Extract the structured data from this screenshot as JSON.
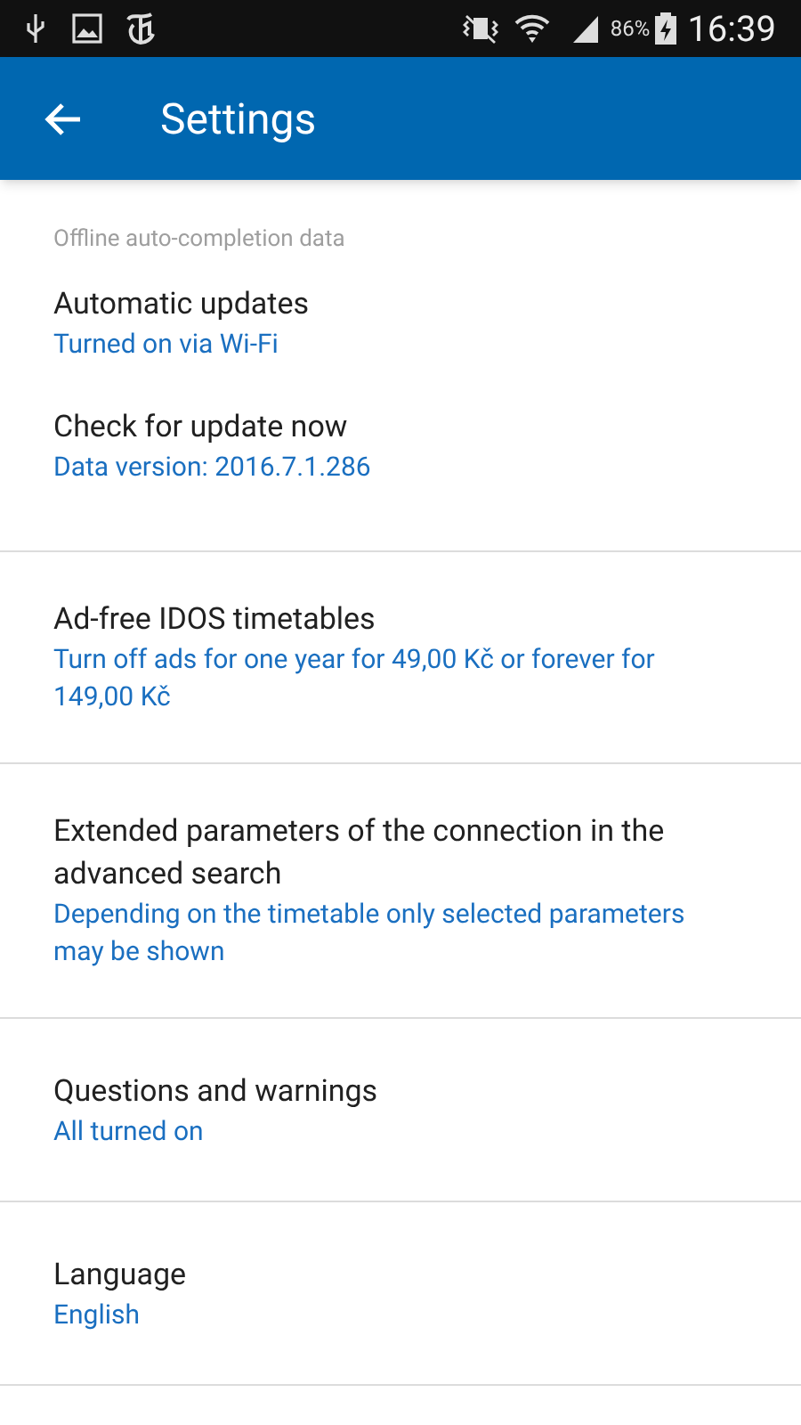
{
  "status_bar": {
    "battery": "86%",
    "time": "16:39"
  },
  "app_bar": {
    "title": "Settings"
  },
  "sections": [
    {
      "header": "Offline auto-completion data",
      "items": [
        {
          "title": "Automatic updates",
          "summary": "Turned on via Wi-Fi"
        },
        {
          "title": "Check for update now",
          "summary": "Data version: 2016.7.1.286"
        }
      ]
    },
    {
      "items": [
        {
          "title": "Ad-free IDOS timetables",
          "summary": "Turn off ads for one year for 49,00 Kč or forever for 149,00 Kč"
        }
      ]
    },
    {
      "items": [
        {
          "title": "Extended parameters of the connection in the advanced search",
          "summary": "Depending on the timetable only selected parameters may be shown"
        }
      ]
    },
    {
      "items": [
        {
          "title": "Questions and warnings",
          "summary": "All turned on"
        }
      ]
    },
    {
      "items": [
        {
          "title": "Language",
          "summary": "English"
        }
      ]
    }
  ]
}
